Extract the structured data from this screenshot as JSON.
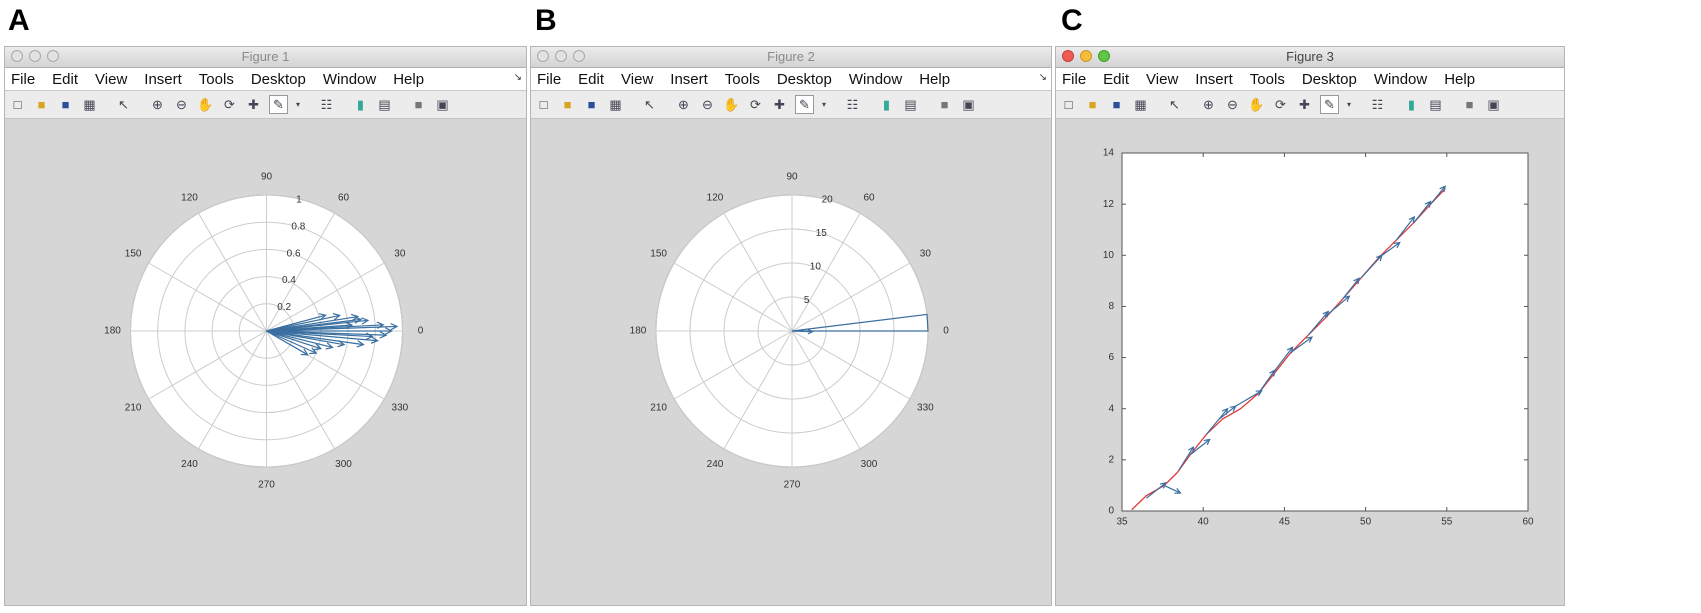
{
  "panels": [
    {
      "letter": "A",
      "title": "Figure 1"
    },
    {
      "letter": "B",
      "title": "Figure 2"
    },
    {
      "letter": "C",
      "title": "Figure 3"
    }
  ],
  "menu": [
    "File",
    "Edit",
    "View",
    "Insert",
    "Tools",
    "Desktop",
    "Window",
    "Help"
  ],
  "menu_corner_icon": "dock-arrow-icon",
  "toolbar_icons": [
    "new-figure-icon",
    "open-file-icon",
    "save-icon",
    "print-icon",
    "pointer-icon",
    "zoom-in-icon",
    "zoom-out-icon",
    "pan-hand-icon",
    "rotate-3d-icon",
    "data-cursor-icon",
    "brush-icon",
    "dropdown-arrow-icon",
    "link-plot-icon",
    "colorbar-icon",
    "legend-icon",
    "hide-plot-tools-icon",
    "show-plot-tools-icon"
  ],
  "colors": {
    "arrow": "#3a6fa0",
    "trajectory": "#e23a3a",
    "grid": "#cccccc",
    "figure_bg": "#d6d6d6"
  },
  "chart_data": [
    {
      "type": "polar-compass",
      "angle_ticks": [
        "0",
        "30",
        "60",
        "90",
        "120",
        "150",
        "180",
        "210",
        "240",
        "270",
        "300",
        "330"
      ],
      "radial_ticks": [
        "0.2",
        "0.4",
        "0.6",
        "0.8",
        "1"
      ],
      "rmax": 1,
      "arrows": [
        {
          "theta": 0,
          "r": 0.92
        },
        {
          "theta": 3,
          "r": 0.86
        },
        {
          "theta": -2,
          "r": 0.88
        },
        {
          "theta": 6,
          "r": 0.75
        },
        {
          "theta": -5,
          "r": 0.82
        },
        {
          "theta": 9,
          "r": 0.68
        },
        {
          "theta": 12,
          "r": 0.55
        },
        {
          "theta": -8,
          "r": 0.72
        },
        {
          "theta": 4,
          "r": 0.63
        },
        {
          "theta": -10,
          "r": 0.58
        },
        {
          "theta": 15,
          "r": 0.45
        },
        {
          "theta": -14,
          "r": 0.5
        },
        {
          "theta": -18,
          "r": 0.42
        },
        {
          "theta": -24,
          "r": 0.4
        },
        {
          "theta": -30,
          "r": 0.35
        },
        {
          "theta": 2,
          "r": 0.96
        },
        {
          "theta": -3,
          "r": 0.78
        },
        {
          "theta": 7,
          "r": 0.7
        }
      ]
    },
    {
      "type": "rose",
      "angle_ticks": [
        "0",
        "30",
        "60",
        "90",
        "120",
        "150",
        "180",
        "210",
        "240",
        "270",
        "300",
        "330"
      ],
      "radial_ticks": [
        "5",
        "10",
        "15",
        "20"
      ],
      "rmax": 20,
      "bins": [
        {
          "theta_start": 0,
          "theta_end": 7,
          "count": 20
        }
      ],
      "arrows": [
        {
          "theta": -2,
          "r": 3
        }
      ]
    },
    {
      "type": "line",
      "xlim": [
        35,
        60
      ],
      "ylim": [
        0,
        14
      ],
      "xticks": [
        "35",
        "40",
        "45",
        "50",
        "55",
        "60"
      ],
      "yticks": [
        "0",
        "2",
        "4",
        "6",
        "8",
        "10",
        "12",
        "14"
      ],
      "series": [
        {
          "x": [
            35.6,
            36.5,
            37.6,
            38.4,
            39.2,
            40.2,
            41.2,
            42.3,
            43.4,
            44.4,
            45.4,
            46.5,
            47.6,
            48.6,
            49.7,
            50.8,
            51.9,
            53.0,
            54.0,
            54.9
          ],
          "y": [
            0.05,
            0.6,
            1.0,
            1.5,
            2.2,
            3.0,
            3.6,
            4.0,
            4.6,
            5.4,
            6.2,
            6.9,
            7.6,
            8.3,
            9.1,
            9.9,
            10.6,
            11.3,
            12.0,
            12.6
          ]
        }
      ],
      "quiver": [
        {
          "x": 36.5,
          "y": 0.5,
          "u": 1.2,
          "v": 0.6
        },
        {
          "x": 37.6,
          "y": 1.0,
          "u": 1.0,
          "v": -0.3
        },
        {
          "x": 38.5,
          "y": 1.6,
          "u": 0.9,
          "v": 0.9
        },
        {
          "x": 39.2,
          "y": 2.2,
          "u": 1.2,
          "v": 0.6
        },
        {
          "x": 40.2,
          "y": 3.0,
          "u": 1.3,
          "v": 1.0
        },
        {
          "x": 41.0,
          "y": 3.6,
          "u": 1.0,
          "v": 0.5
        },
        {
          "x": 42.0,
          "y": 4.1,
          "u": 1.6,
          "v": 0.6
        },
        {
          "x": 43.4,
          "y": 4.6,
          "u": 1.0,
          "v": 0.9
        },
        {
          "x": 44.3,
          "y": 5.4,
          "u": 1.2,
          "v": 1.0
        },
        {
          "x": 45.4,
          "y": 6.2,
          "u": 1.3,
          "v": 0.6
        },
        {
          "x": 46.5,
          "y": 6.9,
          "u": 1.2,
          "v": 0.9
        },
        {
          "x": 47.5,
          "y": 7.6,
          "u": 1.5,
          "v": 0.8
        },
        {
          "x": 48.6,
          "y": 8.3,
          "u": 1.0,
          "v": 0.8
        },
        {
          "x": 49.7,
          "y": 9.1,
          "u": 1.3,
          "v": 0.9
        },
        {
          "x": 50.8,
          "y": 9.9,
          "u": 1.3,
          "v": 0.6
        },
        {
          "x": 51.9,
          "y": 10.6,
          "u": 1.1,
          "v": 0.9
        },
        {
          "x": 53.0,
          "y": 11.3,
          "u": 1.0,
          "v": 0.8
        },
        {
          "x": 54.0,
          "y": 12.0,
          "u": 0.9,
          "v": 0.7
        }
      ]
    }
  ]
}
